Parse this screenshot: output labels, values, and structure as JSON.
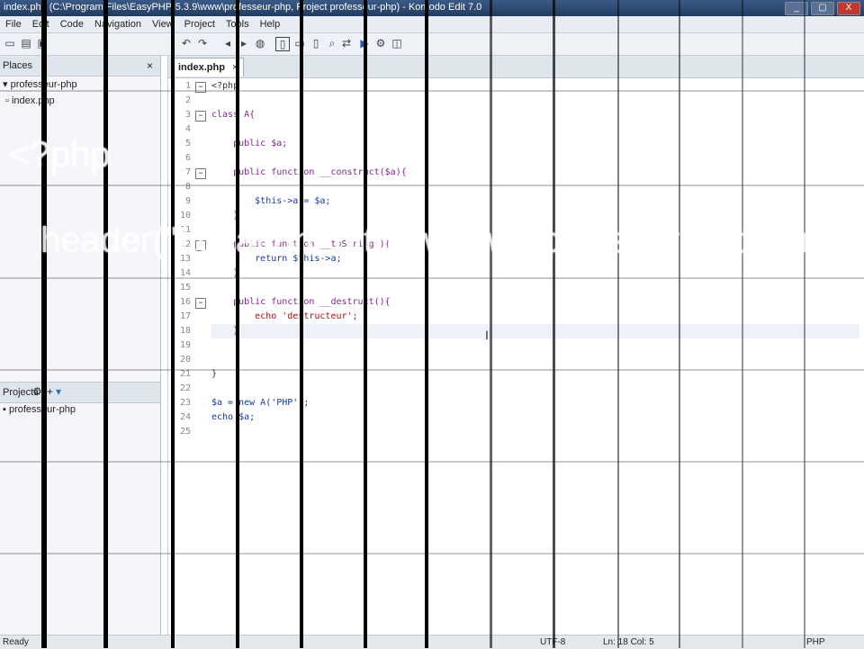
{
  "window": {
    "title": "index.php (C:\\Program Files\\EasyPHP-5.3.9\\www\\professeur-php, Project professeur-php) - Komodo Edit 7.0",
    "minimize": "_",
    "maximize": "▢",
    "close": "X"
  },
  "menu": [
    "File",
    "Edit",
    "Code",
    "Navigation",
    "View",
    "Project",
    "Tools",
    "Help"
  ],
  "left": {
    "places_header": "Places",
    "tree_root": "professeur-php",
    "tree_file": "index.php",
    "projects_header": "Projects",
    "project_name": "professeur-php"
  },
  "editor": {
    "tab_name": "index.php",
    "tab_close": "×",
    "lines": [
      "1",
      "2",
      "3",
      "4",
      "5",
      "6",
      "7",
      "8",
      "9",
      "10",
      "11",
      "12",
      "13",
      "14",
      "15",
      "16",
      "17",
      "18",
      "19",
      "20",
      "21",
      "22",
      "23",
      "24",
      "25"
    ],
    "code": [
      "<?php",
      "",
      "class A{",
      "",
      "    public $a;",
      "",
      "    public function __construct($a){",
      "",
      "        $this->a = $a;",
      "    }",
      "",
      "    public function __toString(){",
      "        return $this->a;",
      "    }",
      "",
      "    public function __destruct(){",
      "        echo 'destructeur';",
      "    }",
      "",
      "",
      "}",
      "",
      "$a = new A('PHP');",
      "echo $a;",
      ""
    ]
  },
  "watermark": {
    "line1": "<?php",
    "line2": "header(\"Location: http://www.professeur-php.com\");"
  },
  "status": {
    "left": "Ready",
    "encoding": "UTF-8",
    "position": "Ln: 18 Col: 5",
    "language": "PHP"
  }
}
